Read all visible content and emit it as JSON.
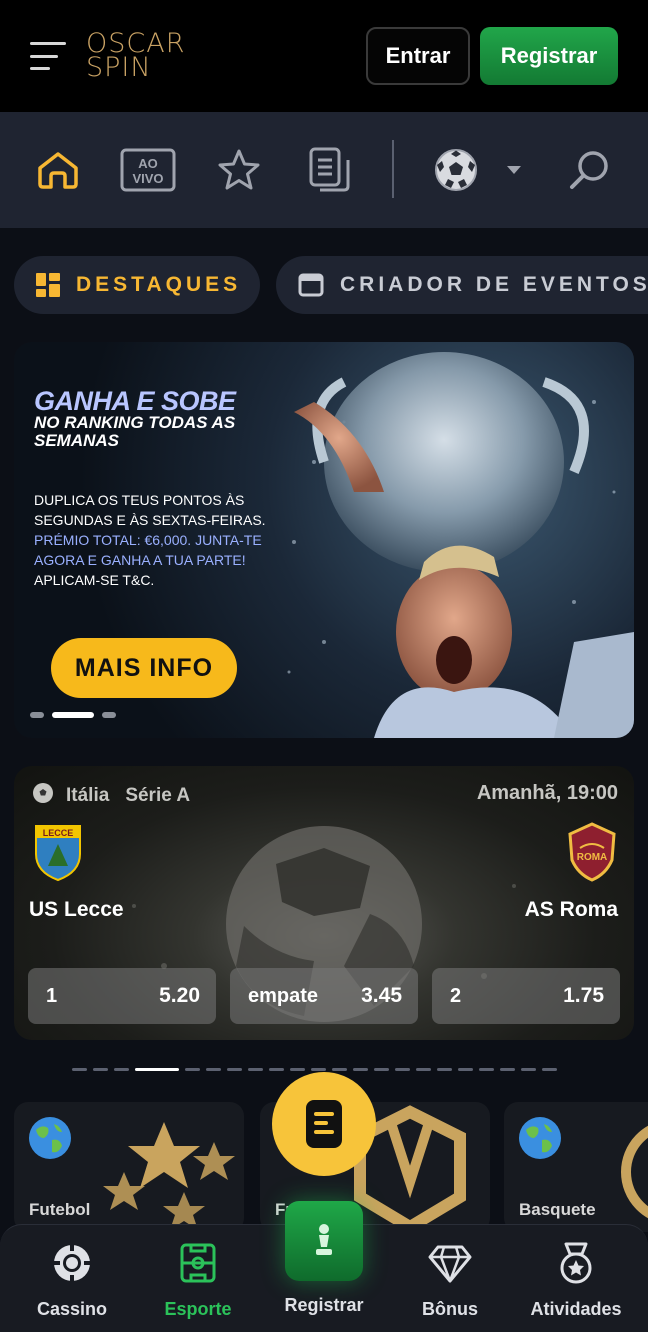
{
  "header": {
    "logo_line1": "OSCAR",
    "logo_line2": "SPIN",
    "login_label": "Entrar",
    "register_label": "Registrar"
  },
  "nav": {
    "live_line1": "AO",
    "live_line2": "VIVO",
    "icons": [
      "home-icon",
      "live-icon",
      "star-icon",
      "betslip-icon",
      "football-icon",
      "chevron-down-icon",
      "search-icon"
    ]
  },
  "tabs": [
    {
      "label": "DESTAQUES",
      "active": true
    },
    {
      "label": "CRIADOR DE EVENTOS",
      "active": false
    }
  ],
  "banner": {
    "title": "GANHA E SOBE",
    "subtitle": "NO RANKING TODAS AS SEMANAS",
    "body_1": "DUPLICA OS TEUS PONTOS ÀS SEGUNDAS E ÀS SEXTAS-FEIRAS.",
    "body_2": "PRÉMIO TOTAL: €6,000. JUNTA-TE AGORA E GANHA A TUA PARTE!",
    "body_3": "APLICAM-SE T&C.",
    "cta": "MAIS INFO",
    "slides": 3,
    "active_slide": 2
  },
  "match": {
    "country": "Itália",
    "league": "Série A",
    "time": "Amanhã, 19:00",
    "home": {
      "name": "US Lecce",
      "crest_text": "LECCE"
    },
    "away": {
      "name": "AS Roma",
      "crest_text": "ROMA"
    },
    "odds": [
      {
        "label": "1",
        "value": "5.20"
      },
      {
        "label": "empate",
        "value": "3.45"
      },
      {
        "label": "2",
        "value": "1.75"
      }
    ]
  },
  "carousel_pager": {
    "count": 22,
    "active": 3
  },
  "sports": [
    {
      "label": "Futebol"
    },
    {
      "label": "Fu"
    },
    {
      "label": "Basquete"
    }
  ],
  "bottom_nav": {
    "items": [
      {
        "label": "Cassino",
        "active": false
      },
      {
        "label": "Esporte",
        "active": true
      },
      {
        "label": "Registrar",
        "active": false
      },
      {
        "label": "Bônus",
        "active": false
      },
      {
        "label": "Atividades",
        "active": false
      }
    ]
  },
  "colors": {
    "accent_gold": "#f7b733",
    "brand_green": "#21a64a",
    "active_green": "#2bc25a",
    "logo_gold": "#c9a264"
  }
}
